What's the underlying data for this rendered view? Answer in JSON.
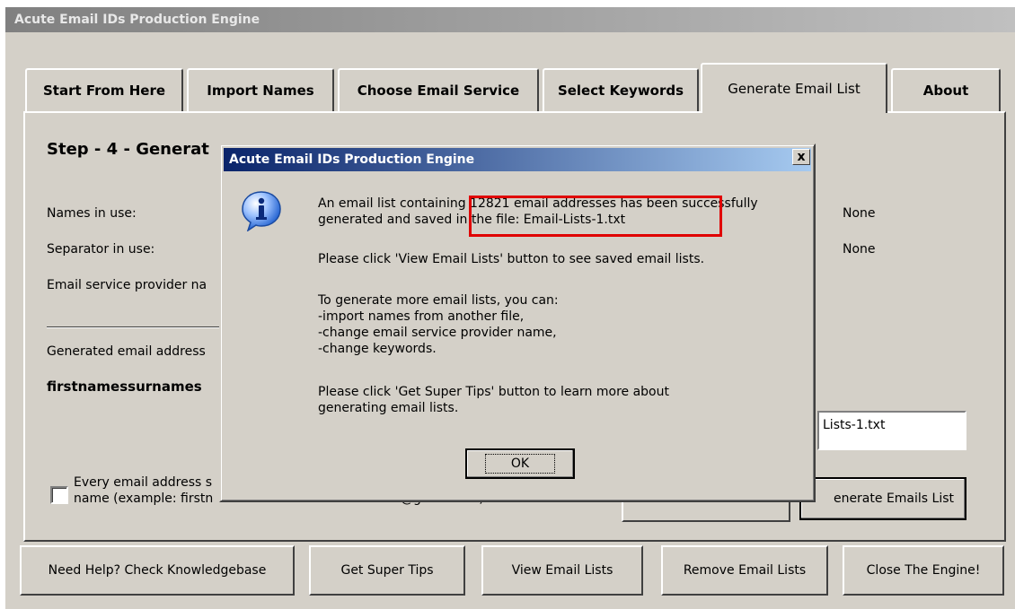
{
  "window": {
    "title": "Acute Email IDs Production Engine"
  },
  "tabs": [
    {
      "label": "Start From Here"
    },
    {
      "label": "Import Names"
    },
    {
      "label": "Choose Email Service"
    },
    {
      "label": "Select Keywords"
    },
    {
      "label": "Generate Email List"
    },
    {
      "label": "About"
    }
  ],
  "panel": {
    "step_title": "Step - 4 - Generat",
    "names_label": "Names in use:",
    "names_value": "None",
    "separator_label": "Separator in use:",
    "separator_value": "None",
    "provider_label": "Email service provider na",
    "generated_label": "Generated email address",
    "generated_sample": "firstnamessurnames",
    "checkbox_line1": "Every email address s",
    "checkbox_line2": "name (example: firstn",
    "checkbox_tail": "@gmail.com)",
    "filename_value": "Lists-1.txt",
    "generate_button": "enerate Emails List"
  },
  "dialog": {
    "title": "Acute Email IDs Production Engine",
    "close": "x",
    "icon": "info-icon",
    "line1": "An email list containing 12821 email addresses has been successfully",
    "line2": "generated and saved in the file: Email-Lists-1.txt",
    "line3": "Please click 'View Email Lists' button to see saved email lists.",
    "line4": "To generate more email lists, you can:",
    "line5": "-import names from another file,",
    "line6": "-change email service provider name,",
    "line7": "-change keywords.",
    "line8": "Please click 'Get Super Tips' button to learn more about",
    "line9": "generating email lists.",
    "ok": "OK"
  },
  "footer": {
    "help": "Need Help? Check Knowledgebase",
    "tips": "Get Super Tips",
    "view": "View Email Lists",
    "remove": "Remove Email Lists",
    "close": "Close The Engine!"
  },
  "colors": {
    "highlight": "#e00000",
    "dialog_title": "#0a246a"
  }
}
